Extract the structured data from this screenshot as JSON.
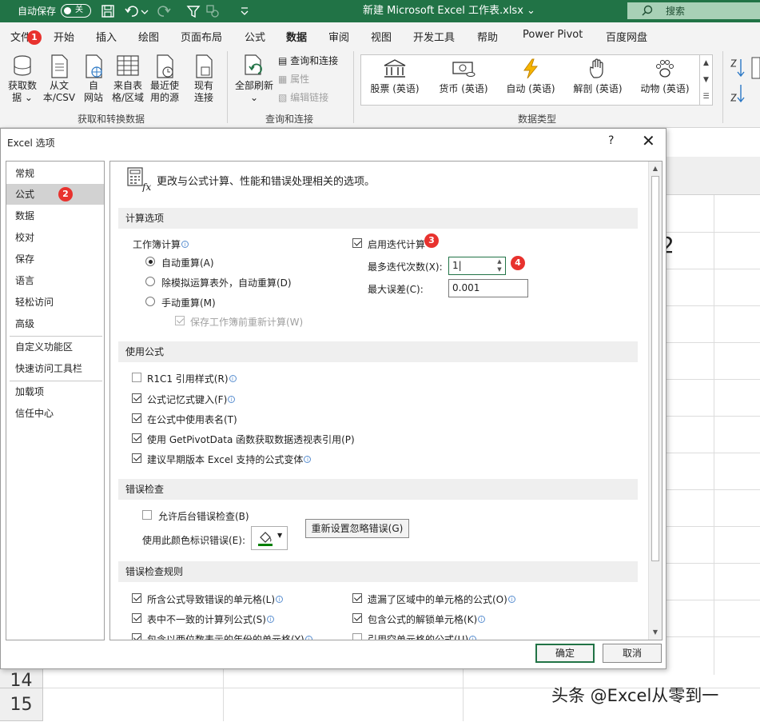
{
  "titlebar": {
    "autosave_label": "自动保存",
    "autosave_state": "关",
    "doc_title": "新建 Microsoft Excel 工作表.xlsx",
    "search_placeholder": "搜索"
  },
  "tabs": [
    "文件",
    "开始",
    "插入",
    "绘图",
    "页面布局",
    "公式",
    "数据",
    "审阅",
    "视图",
    "开发工具",
    "帮助",
    "Power Pivot",
    "百度网盘"
  ],
  "active_tab": "数据",
  "ribbon": {
    "get_data": [
      "获取数",
      "据 ⌄"
    ],
    "from_csv": [
      "从文",
      "本/CSV"
    ],
    "from_web": [
      "自",
      "网站"
    ],
    "from_table": [
      "来自表",
      "格/区域"
    ],
    "recent_sources": [
      "最近使",
      "用的源"
    ],
    "existing_conn": [
      "现有",
      "连接"
    ],
    "group1_label": "获取和转换数据",
    "refresh_all": [
      "全部刷新",
      "⌄"
    ],
    "queries_conn": "查询和连接",
    "properties": "属性",
    "edit_links": "编辑链接",
    "group2_label": "查询和连接",
    "data_types": [
      "股票 (英语)",
      "货币 (英语)",
      "自动 (英语)",
      "解剖 (英语)",
      "动物 (英语)"
    ],
    "group3_label": "数据类型"
  },
  "sheet": {
    "row14": "14",
    "row15": "15",
    "digit": "2",
    "watermark": "头条 @Excel从零到一"
  },
  "dialog": {
    "title": "Excel 选项",
    "help": "?",
    "close": "✕",
    "nav": [
      "常规",
      "公式",
      "数据",
      "校对",
      "保存",
      "语言",
      "轻松访问",
      "高级",
      "自定义功能区",
      "快速访问工具栏",
      "加载项",
      "信任中心"
    ],
    "headline": "更改与公式计算、性能和错误处理相关的选项。",
    "calc": {
      "section": "计算选项",
      "workbook_calc": "工作簿计算",
      "auto": "自动重算(A)",
      "auto_except": "除模拟运算表外，自动重算(D)",
      "manual": "手动重算(M)",
      "recalc_before_save": "保存工作簿前重新计算(W)",
      "enable_iterative": "启用迭代计算",
      "max_iter_label": "最多迭代次数(X):",
      "max_iter_value": "1",
      "max_change_label": "最大误差(C):",
      "max_change_value": "0.001"
    },
    "formulas": {
      "section": "使用公式",
      "r1c1": "R1C1 引用样式(R)",
      "autocomplete": "公式记忆式键入(F)",
      "table_names": "在公式中使用表名(T)",
      "getpivot": "使用 GetPivotData 函数获取数据透视表引用(P)",
      "suggest_variants": "建议早期版本 Excel 支持的公式变体"
    },
    "errors": {
      "section": "错误检查",
      "background": "允许后台错误检查(B)",
      "color_label": "使用此颜色标识错误(E):",
      "reset_button": "重新设置忽略错误(G)"
    },
    "rules": {
      "section": "错误检查规则",
      "r1": "所含公式导致错误的单元格(L)",
      "r2": "表中不一致的计算列公式(S)",
      "r3": "包含以两位数表示的年份的单元格(Y)",
      "r4": "遗漏了区域中的单元格的公式(O)",
      "r5": "包含公式的解锁单元格(K)",
      "r6": "引用空单元格的公式(U)"
    },
    "ok": "确定",
    "cancel": "取消"
  },
  "badges": [
    "1",
    "2",
    "3",
    "4"
  ],
  "colors": {
    "brand": "#217346",
    "badge": "#e8322e",
    "error_indicator": "#008000"
  }
}
